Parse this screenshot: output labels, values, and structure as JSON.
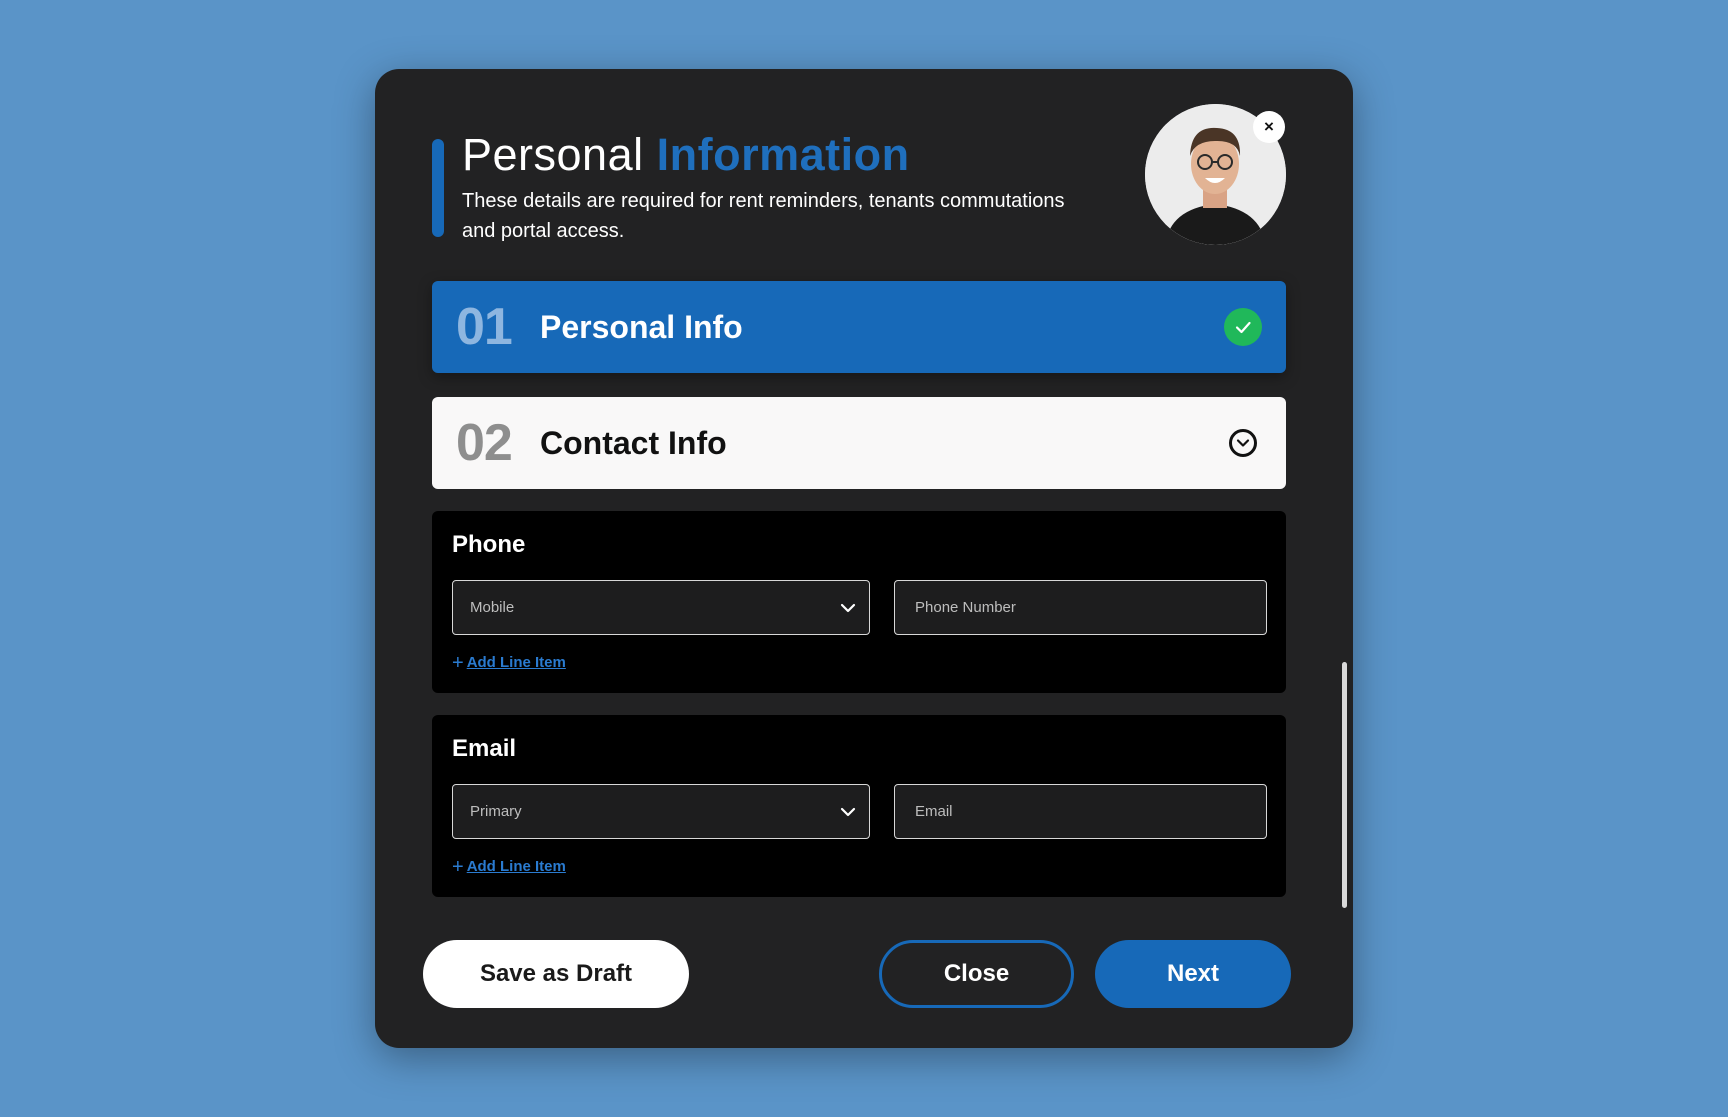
{
  "header": {
    "title_plain": "Personal",
    "title_accent": "Information",
    "subtitle": "These details are required for rent reminders, tenants commutations and portal access.",
    "avatar_close": "×"
  },
  "steps": [
    {
      "number": "01",
      "label": "Personal Info",
      "status": "completed",
      "status_icon": "check-icon"
    },
    {
      "number": "02",
      "label": "Contact Info",
      "status": "expanded",
      "status_icon": "chevron-down-circle-icon"
    }
  ],
  "phone": {
    "title": "Phone",
    "type_selected": "Mobile",
    "number_placeholder": "Phone Number",
    "add_label": "Add Line Item",
    "add_icon": "+"
  },
  "email": {
    "title": "Email",
    "type_selected": "Primary",
    "address_placeholder": "Email",
    "add_label": "Add Line Item",
    "add_icon": "+"
  },
  "footer": {
    "save_draft": "Save as Draft",
    "close": "Close",
    "next": "Next"
  },
  "colors": {
    "background": "#5a94c8",
    "modal": "#222223",
    "accent": "#1769b8",
    "success": "#20b85a",
    "link": "#2a7bd0"
  }
}
